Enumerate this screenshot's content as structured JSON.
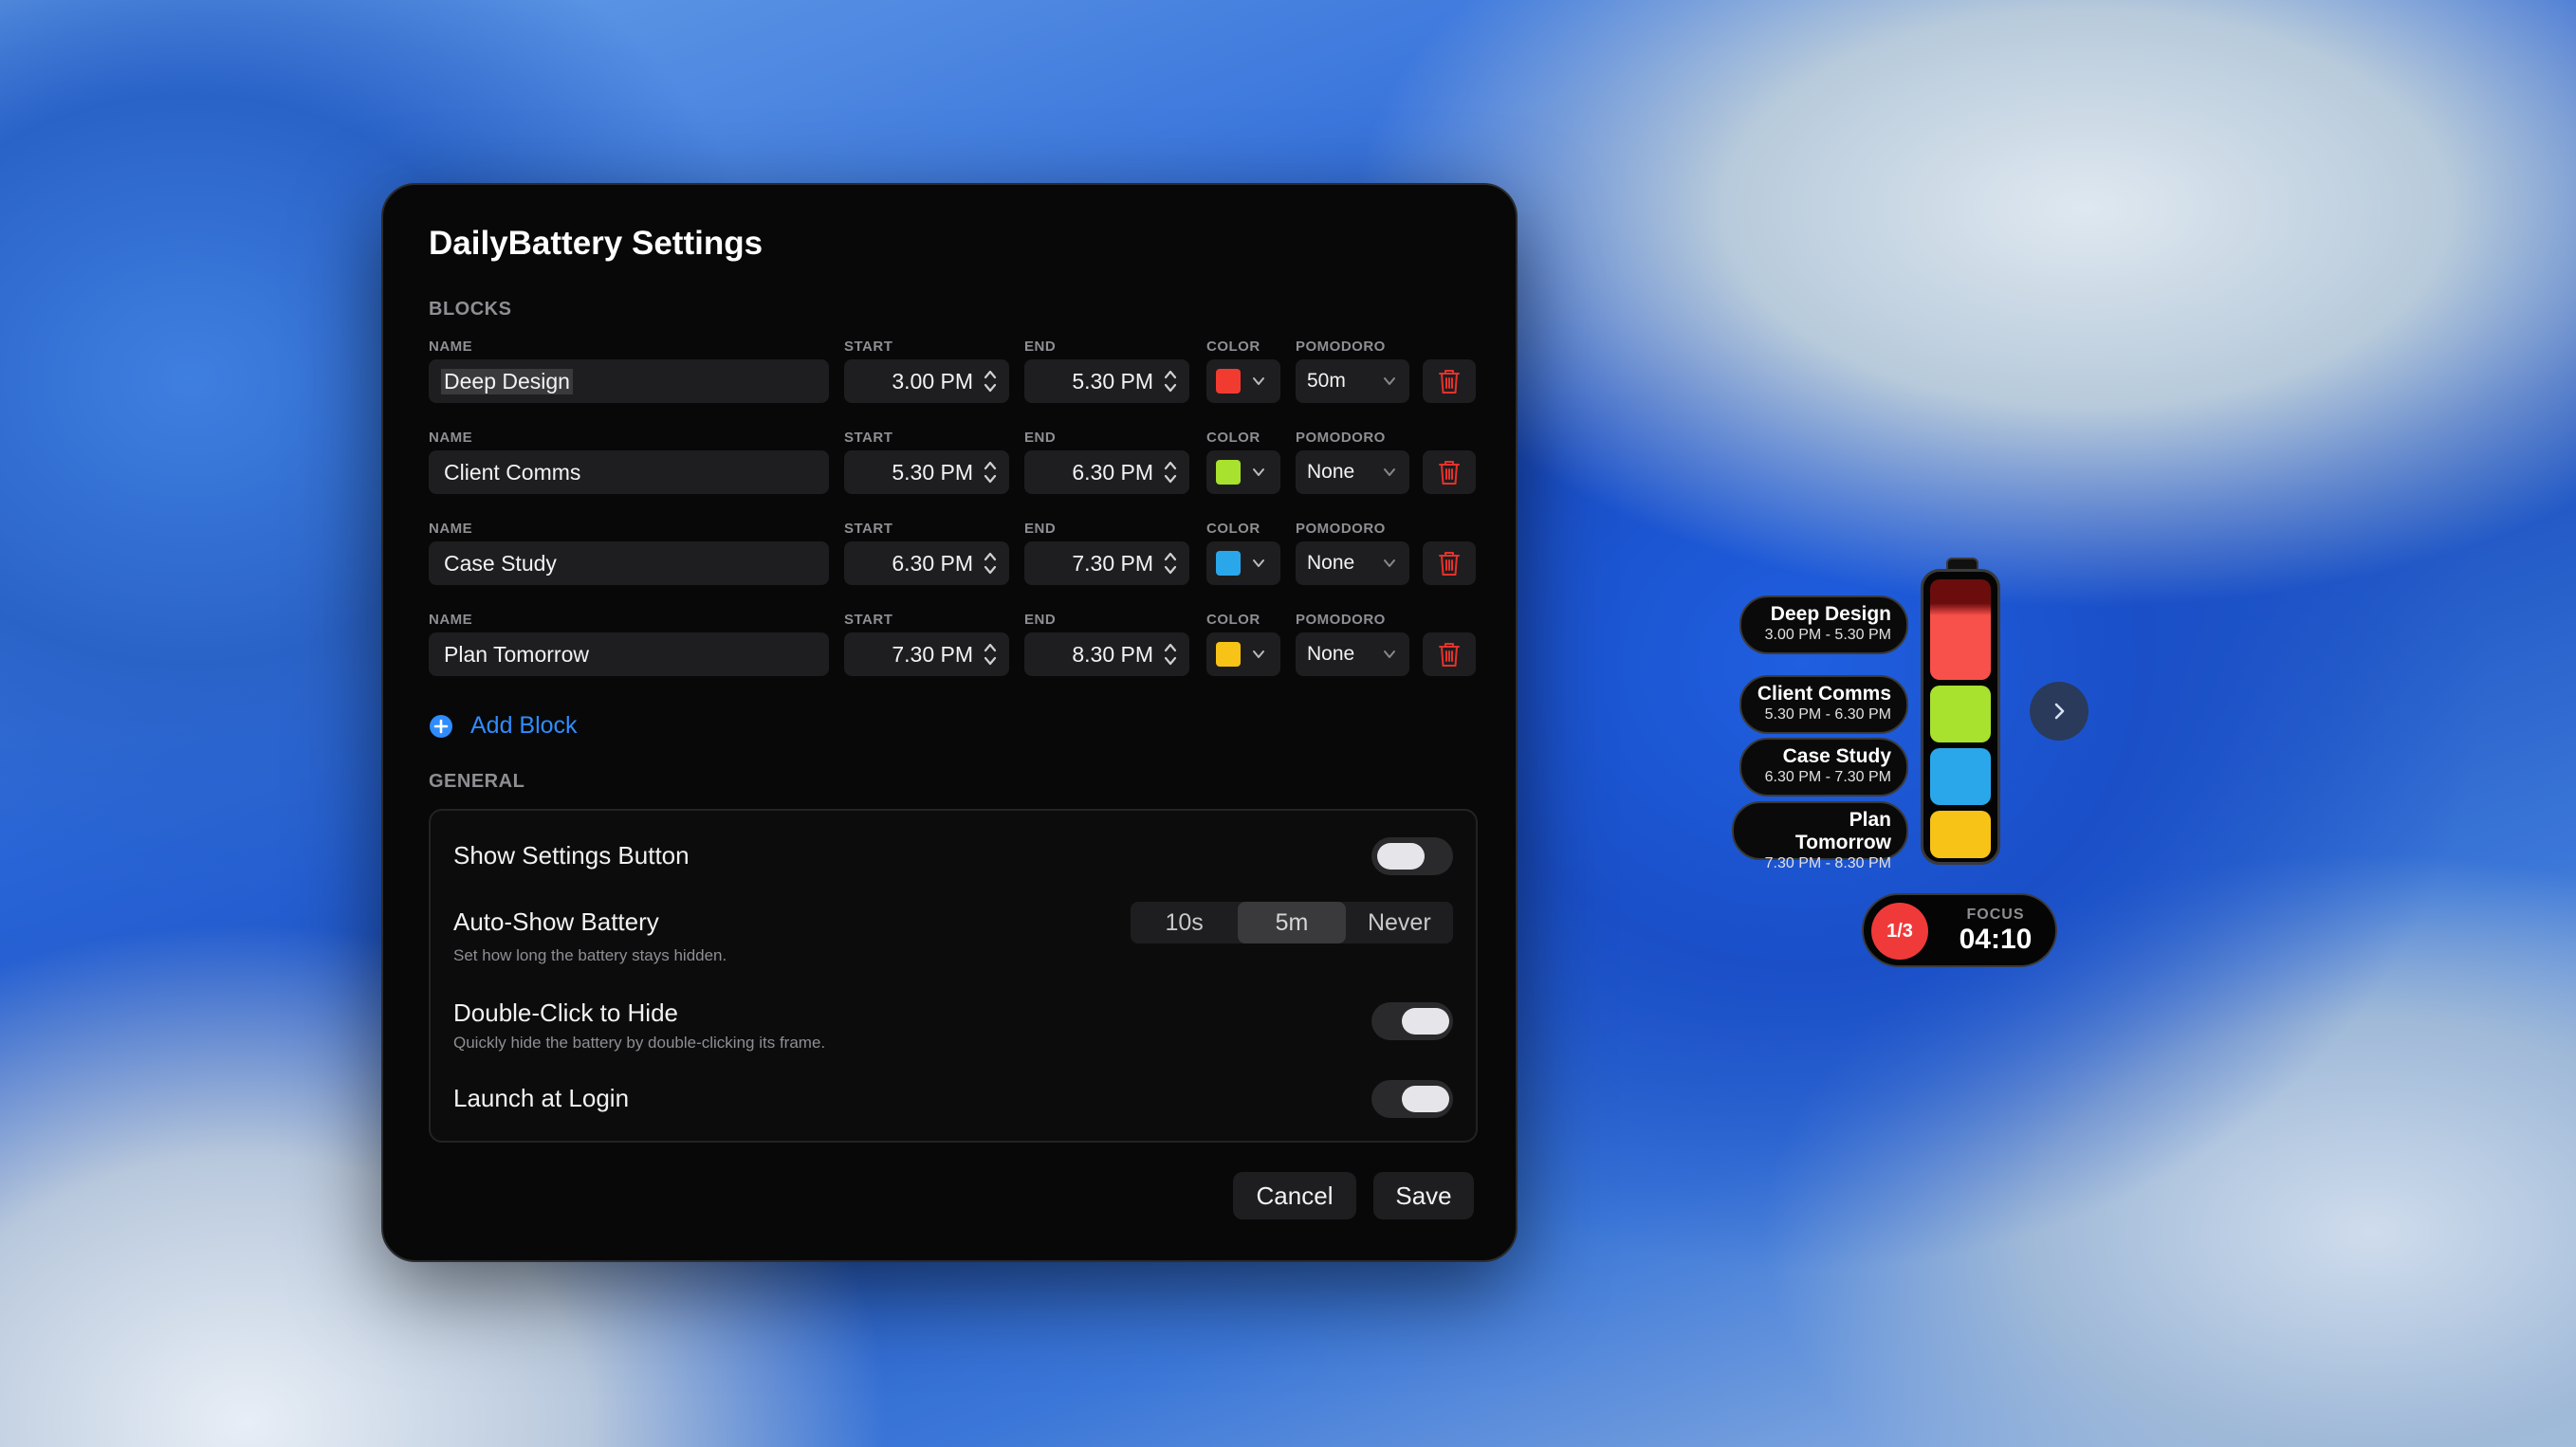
{
  "window": {
    "title": "DailyBattery Settings",
    "blocks_heading": "BLOCKS",
    "general_heading": "GENERAL",
    "field_labels": {
      "name": "NAME",
      "start": "START",
      "end": "END",
      "color": "COLOR",
      "pomodoro": "POMODORO"
    },
    "blocks": [
      {
        "name": "Deep Design",
        "start": "3.00 PM",
        "end": "5.30 PM",
        "color": "#f23b30",
        "pomodoro": "50m"
      },
      {
        "name": "Client Comms",
        "start": "5.30 PM",
        "end": "6.30 PM",
        "color": "#a8e12e",
        "pomodoro": "None"
      },
      {
        "name": "Case Study",
        "start": "6.30 PM",
        "end": "7.30 PM",
        "color": "#2aa7ea",
        "pomodoro": "None"
      },
      {
        "name": "Plan Tomorrow",
        "start": "7.30 PM",
        "end": "8.30 PM",
        "color": "#f7c316",
        "pomodoro": "None"
      }
    ],
    "add_block_label": "Add Block",
    "general": {
      "show_settings": {
        "title": "Show Settings Button",
        "enabled": false
      },
      "auto_show": {
        "title": "Auto-Show Battery",
        "subtitle": "Set how long the battery stays hidden.",
        "options": [
          "10s",
          "5m",
          "Never"
        ],
        "selected": "5m"
      },
      "double_click": {
        "title": "Double-Click to Hide",
        "subtitle": "Quickly hide the battery by double-clicking its frame.",
        "enabled": true
      },
      "launch_login": {
        "title": "Launch at Login",
        "enabled": true
      }
    },
    "cancel_label": "Cancel",
    "save_label": "Save"
  },
  "widget": {
    "pills": [
      {
        "name": "Deep Design",
        "time": "3.00 PM - 5.30 PM"
      },
      {
        "name": "Client Comms",
        "time": "5.30 PM - 6.30 PM"
      },
      {
        "name": "Case Study",
        "time": "6.30 PM - 7.30 PM"
      },
      {
        "name": "Plan Tomorrow",
        "time": "7.30 PM - 8.30 PM"
      }
    ],
    "battery_colors": {
      "deep_design_used": "#6b0d0d",
      "deep_design": "#f8504a",
      "client_comms": "#a8e12e",
      "case_study": "#2aa7ea",
      "plan_tomorrow": "#f7c316"
    },
    "focus": {
      "counter": "1/3",
      "label": "FOCUS",
      "time": "04:10",
      "badge_color": "#f03a3a"
    }
  },
  "icons": {
    "stepper": "up-down-chevrons-icon",
    "dropdown": "chevron-down-icon",
    "delete": "trash-icon",
    "add": "plus-circle-icon",
    "next": "chevron-right-icon"
  },
  "accent_color": "#2f8cff"
}
